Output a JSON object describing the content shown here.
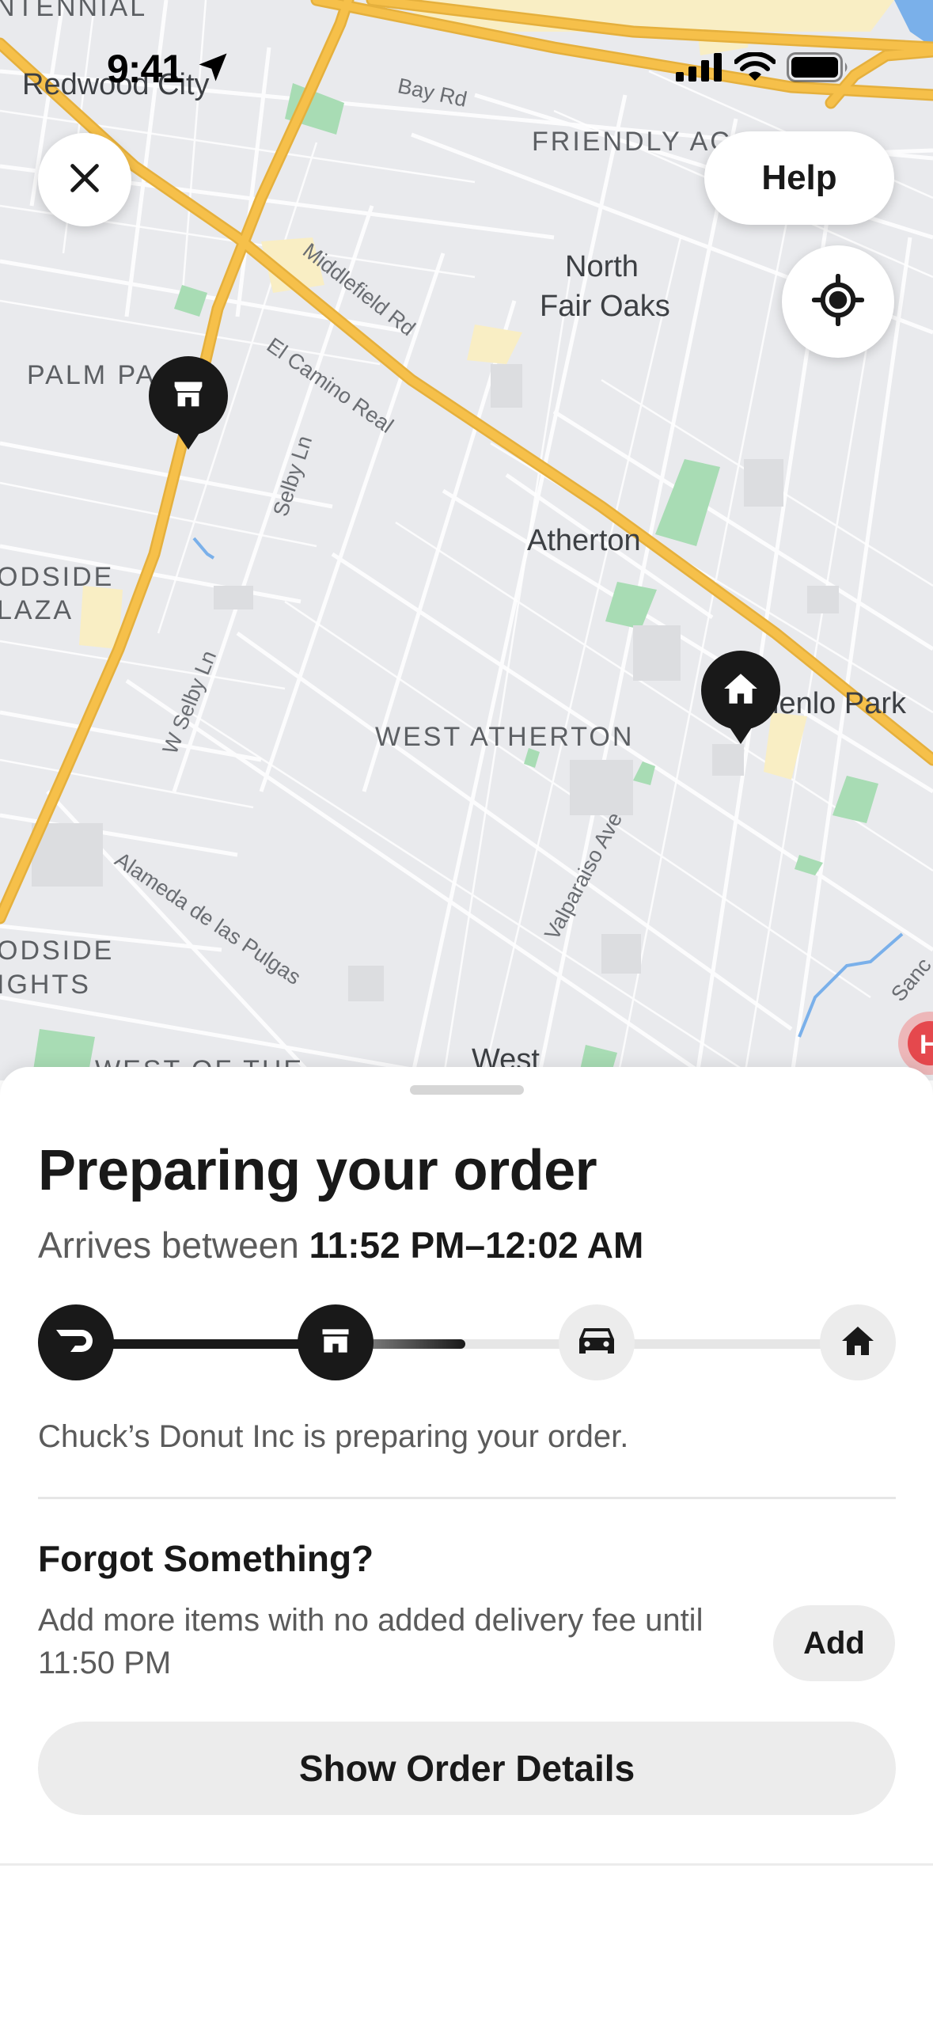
{
  "status_bar": {
    "time": "9:41"
  },
  "map": {
    "buttons": {
      "help_label": "Help"
    },
    "area_labels": [
      "NTENNIAL",
      "FRIENDLY AC",
      "PALM PA",
      "ODSIDE",
      "LAZA",
      "WEST ATHERTON",
      "ODSIDE",
      "IGHTS",
      "WEST OF THE"
    ],
    "town_labels": [
      "Redwood City",
      "North",
      "Fair Oaks",
      "Atherton",
      "lenlo Park",
      "West"
    ],
    "road_labels": [
      "Bay Rd",
      "Middlefield Rd",
      "El Camino Real",
      "Selby Ln",
      "W Selby Ln",
      "Alameda de las Pulgas",
      "Valparaiso Ave",
      "Sanc"
    ],
    "pins": {
      "store_icon": "storefront-icon",
      "home_icon": "home-icon"
    },
    "colors": {
      "highway": "#f6c04a",
      "park": "#a8dcb4",
      "water": "#7ab0ea",
      "hospital": "#e5484d"
    }
  },
  "order": {
    "title": "Preparing your order",
    "eta_prefix": "Arrives between",
    "eta_window": "11:52 PM–12:02 AM",
    "progress": {
      "current_step": 2,
      "steps": [
        {
          "name": "ordered",
          "icon": "doordash-logo-icon",
          "state": "done"
        },
        {
          "name": "preparing",
          "icon": "storefront-icon",
          "state": "done"
        },
        {
          "name": "delivering",
          "icon": "car-icon",
          "state": "pending"
        },
        {
          "name": "delivered",
          "icon": "home-icon",
          "state": "pending"
        }
      ]
    },
    "status_message": "Chuck’s Donut Inc is preparing your order.",
    "forgot": {
      "title": "Forgot Something?",
      "body": "Add more items with no added delivery fee until 11:50 PM",
      "add_label": "Add"
    },
    "details_label": "Show Order Details"
  },
  "colors": {
    "primary": "#191919",
    "secondary_text": "#5b5b5b",
    "pill_bg": "#ececec"
  }
}
